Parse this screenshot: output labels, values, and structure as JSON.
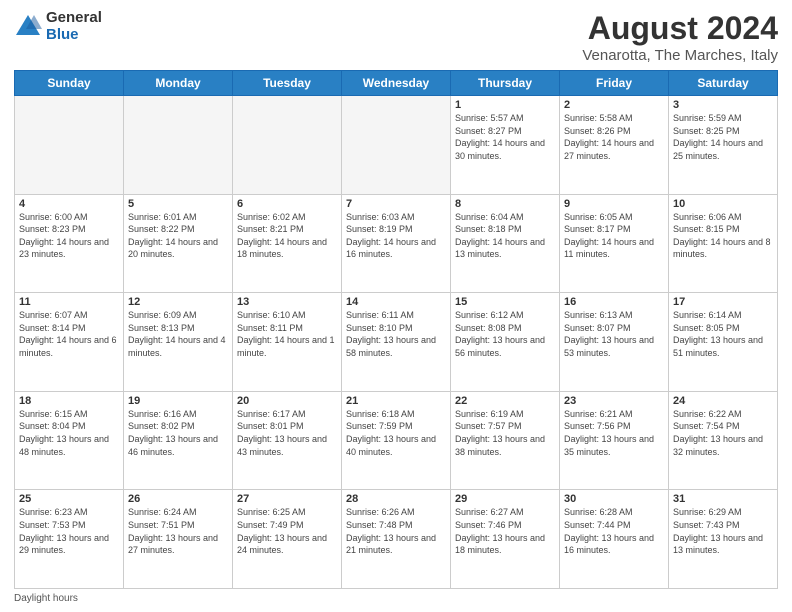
{
  "logo": {
    "general": "General",
    "blue": "Blue"
  },
  "header": {
    "title": "August 2024",
    "subtitle": "Venarotta, The Marches, Italy"
  },
  "weekdays": [
    "Sunday",
    "Monday",
    "Tuesday",
    "Wednesday",
    "Thursday",
    "Friday",
    "Saturday"
  ],
  "weeks": [
    [
      {
        "day": "",
        "empty": true
      },
      {
        "day": "",
        "empty": true
      },
      {
        "day": "",
        "empty": true
      },
      {
        "day": "",
        "empty": true
      },
      {
        "day": "1",
        "sunrise": "Sunrise: 5:57 AM",
        "sunset": "Sunset: 8:27 PM",
        "daylight": "Daylight: 14 hours and 30 minutes."
      },
      {
        "day": "2",
        "sunrise": "Sunrise: 5:58 AM",
        "sunset": "Sunset: 8:26 PM",
        "daylight": "Daylight: 14 hours and 27 minutes."
      },
      {
        "day": "3",
        "sunrise": "Sunrise: 5:59 AM",
        "sunset": "Sunset: 8:25 PM",
        "daylight": "Daylight: 14 hours and 25 minutes."
      }
    ],
    [
      {
        "day": "4",
        "sunrise": "Sunrise: 6:00 AM",
        "sunset": "Sunset: 8:23 PM",
        "daylight": "Daylight: 14 hours and 23 minutes."
      },
      {
        "day": "5",
        "sunrise": "Sunrise: 6:01 AM",
        "sunset": "Sunset: 8:22 PM",
        "daylight": "Daylight: 14 hours and 20 minutes."
      },
      {
        "day": "6",
        "sunrise": "Sunrise: 6:02 AM",
        "sunset": "Sunset: 8:21 PM",
        "daylight": "Daylight: 14 hours and 18 minutes."
      },
      {
        "day": "7",
        "sunrise": "Sunrise: 6:03 AM",
        "sunset": "Sunset: 8:19 PM",
        "daylight": "Daylight: 14 hours and 16 minutes."
      },
      {
        "day": "8",
        "sunrise": "Sunrise: 6:04 AM",
        "sunset": "Sunset: 8:18 PM",
        "daylight": "Daylight: 14 hours and 13 minutes."
      },
      {
        "day": "9",
        "sunrise": "Sunrise: 6:05 AM",
        "sunset": "Sunset: 8:17 PM",
        "daylight": "Daylight: 14 hours and 11 minutes."
      },
      {
        "day": "10",
        "sunrise": "Sunrise: 6:06 AM",
        "sunset": "Sunset: 8:15 PM",
        "daylight": "Daylight: 14 hours and 8 minutes."
      }
    ],
    [
      {
        "day": "11",
        "sunrise": "Sunrise: 6:07 AM",
        "sunset": "Sunset: 8:14 PM",
        "daylight": "Daylight: 14 hours and 6 minutes."
      },
      {
        "day": "12",
        "sunrise": "Sunrise: 6:09 AM",
        "sunset": "Sunset: 8:13 PM",
        "daylight": "Daylight: 14 hours and 4 minutes."
      },
      {
        "day": "13",
        "sunrise": "Sunrise: 6:10 AM",
        "sunset": "Sunset: 8:11 PM",
        "daylight": "Daylight: 14 hours and 1 minute."
      },
      {
        "day": "14",
        "sunrise": "Sunrise: 6:11 AM",
        "sunset": "Sunset: 8:10 PM",
        "daylight": "Daylight: 13 hours and 58 minutes."
      },
      {
        "day": "15",
        "sunrise": "Sunrise: 6:12 AM",
        "sunset": "Sunset: 8:08 PM",
        "daylight": "Daylight: 13 hours and 56 minutes."
      },
      {
        "day": "16",
        "sunrise": "Sunrise: 6:13 AM",
        "sunset": "Sunset: 8:07 PM",
        "daylight": "Daylight: 13 hours and 53 minutes."
      },
      {
        "day": "17",
        "sunrise": "Sunrise: 6:14 AM",
        "sunset": "Sunset: 8:05 PM",
        "daylight": "Daylight: 13 hours and 51 minutes."
      }
    ],
    [
      {
        "day": "18",
        "sunrise": "Sunrise: 6:15 AM",
        "sunset": "Sunset: 8:04 PM",
        "daylight": "Daylight: 13 hours and 48 minutes."
      },
      {
        "day": "19",
        "sunrise": "Sunrise: 6:16 AM",
        "sunset": "Sunset: 8:02 PM",
        "daylight": "Daylight: 13 hours and 46 minutes."
      },
      {
        "day": "20",
        "sunrise": "Sunrise: 6:17 AM",
        "sunset": "Sunset: 8:01 PM",
        "daylight": "Daylight: 13 hours and 43 minutes."
      },
      {
        "day": "21",
        "sunrise": "Sunrise: 6:18 AM",
        "sunset": "Sunset: 7:59 PM",
        "daylight": "Daylight: 13 hours and 40 minutes."
      },
      {
        "day": "22",
        "sunrise": "Sunrise: 6:19 AM",
        "sunset": "Sunset: 7:57 PM",
        "daylight": "Daylight: 13 hours and 38 minutes."
      },
      {
        "day": "23",
        "sunrise": "Sunrise: 6:21 AM",
        "sunset": "Sunset: 7:56 PM",
        "daylight": "Daylight: 13 hours and 35 minutes."
      },
      {
        "day": "24",
        "sunrise": "Sunrise: 6:22 AM",
        "sunset": "Sunset: 7:54 PM",
        "daylight": "Daylight: 13 hours and 32 minutes."
      }
    ],
    [
      {
        "day": "25",
        "sunrise": "Sunrise: 6:23 AM",
        "sunset": "Sunset: 7:53 PM",
        "daylight": "Daylight: 13 hours and 29 minutes."
      },
      {
        "day": "26",
        "sunrise": "Sunrise: 6:24 AM",
        "sunset": "Sunset: 7:51 PM",
        "daylight": "Daylight: 13 hours and 27 minutes."
      },
      {
        "day": "27",
        "sunrise": "Sunrise: 6:25 AM",
        "sunset": "Sunset: 7:49 PM",
        "daylight": "Daylight: 13 hours and 24 minutes."
      },
      {
        "day": "28",
        "sunrise": "Sunrise: 6:26 AM",
        "sunset": "Sunset: 7:48 PM",
        "daylight": "Daylight: 13 hours and 21 minutes."
      },
      {
        "day": "29",
        "sunrise": "Sunrise: 6:27 AM",
        "sunset": "Sunset: 7:46 PM",
        "daylight": "Daylight: 13 hours and 18 minutes."
      },
      {
        "day": "30",
        "sunrise": "Sunrise: 6:28 AM",
        "sunset": "Sunset: 7:44 PM",
        "daylight": "Daylight: 13 hours and 16 minutes."
      },
      {
        "day": "31",
        "sunrise": "Sunrise: 6:29 AM",
        "sunset": "Sunset: 7:43 PM",
        "daylight": "Daylight: 13 hours and 13 minutes."
      }
    ]
  ],
  "footer": {
    "label": "Daylight hours"
  }
}
